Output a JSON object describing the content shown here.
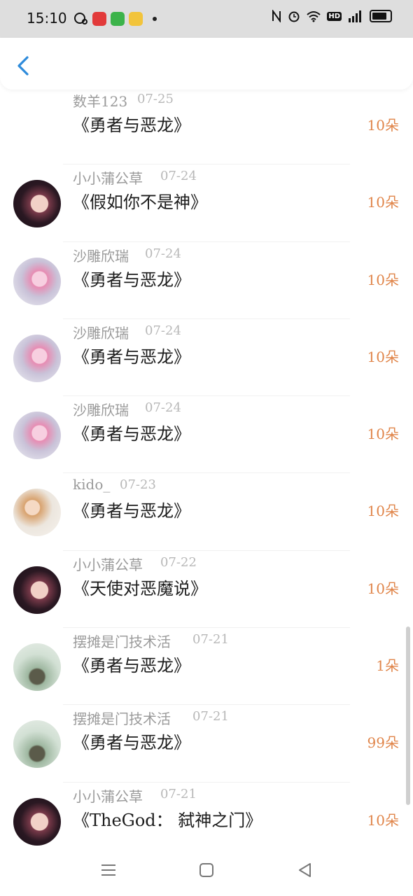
{
  "status_bar": {
    "time": "15:10"
  },
  "colors": {
    "accent": "#2e8bdb",
    "amount": "#e0854a",
    "username": "#9a9a9a",
    "title": "#1c1c1c"
  },
  "header": {
    "back_icon": "chevron-left-icon"
  },
  "items": [
    {
      "user": "数羊123",
      "date": "07-25",
      "title": "《勇者与恶龙》",
      "amount": "10朵",
      "avatar": "hidden"
    },
    {
      "user": "小小蒲公草",
      "date": "07-24",
      "title": "《假如你不是神》",
      "amount": "10朵",
      "avatar": "dark"
    },
    {
      "user": "沙雕欣瑞",
      "date": "07-24",
      "title": "《勇者与恶龙》",
      "amount": "10朵",
      "avatar": "pink"
    },
    {
      "user": "沙雕欣瑞",
      "date": "07-24",
      "title": "《勇者与恶龙》",
      "amount": "10朵",
      "avatar": "pink"
    },
    {
      "user": "沙雕欣瑞",
      "date": "07-24",
      "title": "《勇者与恶龙》",
      "amount": "10朵",
      "avatar": "pink"
    },
    {
      "user": "kido_",
      "date": "07-23",
      "title": "《勇者与恶龙》",
      "amount": "10朵",
      "avatar": "anime"
    },
    {
      "user": "小小蒲公草",
      "date": "07-22",
      "title": "《天使对恶魔说》",
      "amount": "10朵",
      "avatar": "dark"
    },
    {
      "user": "摆摊是门技术活",
      "date": "07-21",
      "title": "《勇者与恶龙》",
      "amount": "1朵",
      "avatar": "plant"
    },
    {
      "user": "摆摊是门技术活",
      "date": "07-21",
      "title": "《勇者与恶龙》",
      "amount": "99朵",
      "avatar": "plant"
    },
    {
      "user": "小小蒲公草",
      "date": "07-21",
      "title": "《TheGod： 弑神之门》",
      "amount": "10朵",
      "avatar": "dark"
    }
  ],
  "nav": {
    "menu_icon": "menu-icon",
    "home_icon": "home-square-icon",
    "back_icon": "back-triangle-icon"
  }
}
